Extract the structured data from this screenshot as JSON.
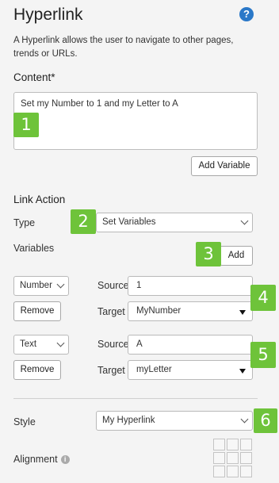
{
  "header": {
    "title": "Hyperlink",
    "help_icon": "?"
  },
  "description": "A Hyperlink allows the user to navigate to other pages, trends or URLs.",
  "content": {
    "label": "Content*",
    "value": "Set my Number to 1 and my Letter to A",
    "add_variable_label": "Add Variable"
  },
  "link_action": {
    "label": "Link Action",
    "type_label": "Type",
    "type_value": "Set Variables",
    "variables_label": "Variables",
    "add_label": "Add",
    "rows": [
      {
        "kind": "Number",
        "remove_label": "Remove",
        "source_label": "Source",
        "source_value": "1",
        "target_label": "Target",
        "target_value": "MyNumber"
      },
      {
        "kind": "Text",
        "remove_label": "Remove",
        "source_label": "Source",
        "source_value": "A",
        "target_label": "Target",
        "target_value": "myLetter"
      }
    ]
  },
  "style": {
    "label": "Style",
    "value": "My Hyperlink"
  },
  "alignment": {
    "label": "Alignment",
    "info_icon": "i"
  },
  "badges": [
    "1",
    "2",
    "3",
    "4",
    "5",
    "6"
  ],
  "colors": {
    "badge": "#6ec33a",
    "help": "#2a78c8"
  }
}
